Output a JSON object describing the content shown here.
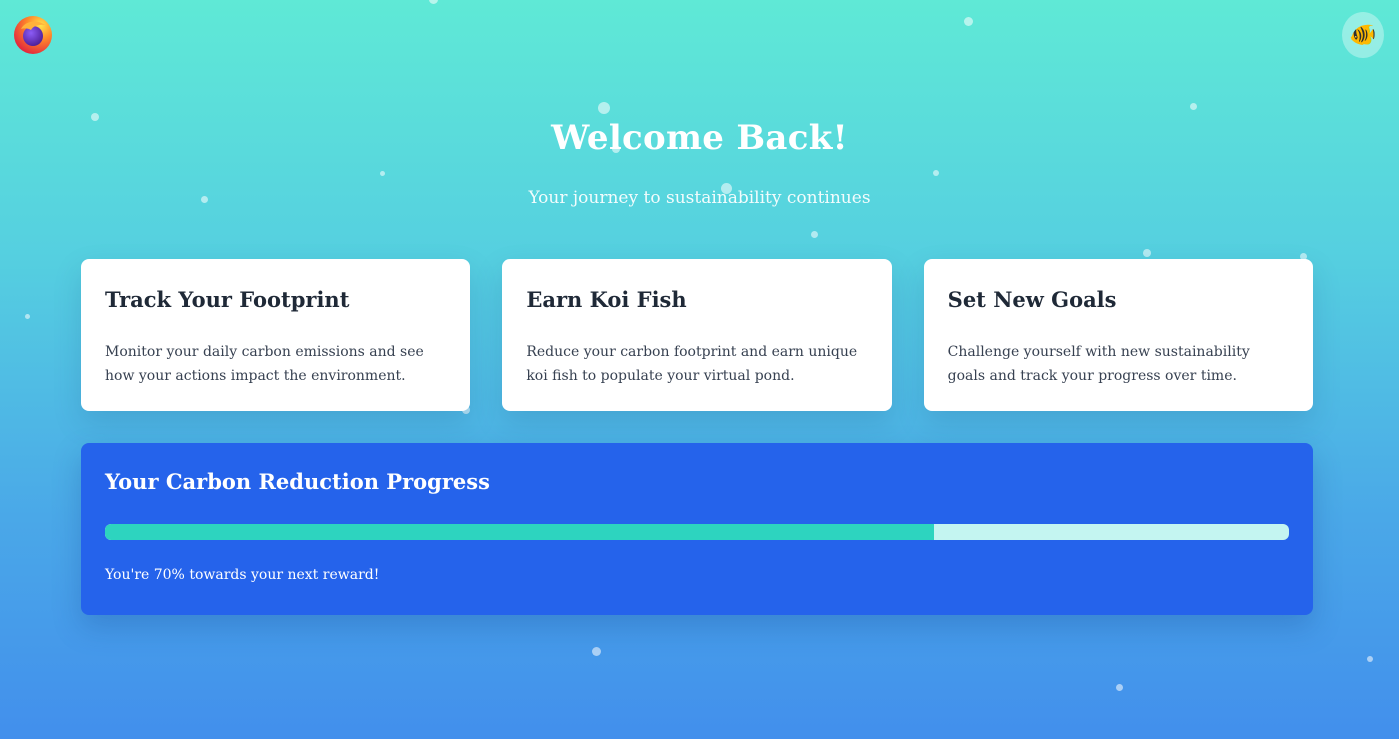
{
  "header": {
    "avatar_emoji": "🐠"
  },
  "hero": {
    "title": "Welcome Back!",
    "subtitle": "Your journey to sustainability continues"
  },
  "cards": [
    {
      "title": "Track Your Footprint",
      "description": "Monitor your daily carbon emissions and see how your actions impact the environment."
    },
    {
      "title": "Earn Koi Fish",
      "description": "Reduce your carbon footprint and earn unique koi fish to populate your virtual pond."
    },
    {
      "title": "Set New Goals",
      "description": "Challenge yourself with new sustainability goals and track your progress over time."
    }
  ],
  "progress": {
    "title": "Your Carbon Reduction Progress",
    "percent": 70,
    "message": "You're 70% towards your next reward!"
  },
  "colors": {
    "primary": "#2563eb",
    "progress_fill": "#2dd4bf",
    "progress_track": "#c4f5f1",
    "background_top": "#5fe9d6",
    "background_bottom": "#428fec"
  },
  "icons": {
    "logo": "firefox-logo-icon",
    "avatar": "fish-avatar-icon"
  }
}
